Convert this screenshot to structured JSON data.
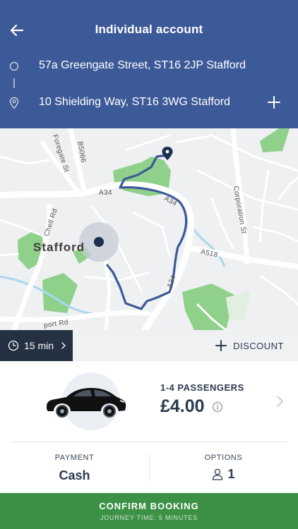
{
  "header": {
    "title": "Individual account",
    "from_address": "57a Greengate Street, ST16 2JP Stafford",
    "to_address": "10 Shielding Way, ST16 3WG Stafford",
    "background_color": "#3d5a98"
  },
  "map": {
    "city": "Stafford",
    "road_labels": {
      "a34_west": "A34",
      "a34_east": "A34",
      "a34_south": "A34",
      "a518": "A518",
      "b5066": "B5066",
      "foregate": "Foregate St",
      "corporation": "Corporation St",
      "chell": "Chell Rd",
      "port": "port Rd"
    },
    "route_color": "#3d5a98"
  },
  "info_bar": {
    "eta": "15 min",
    "discount_label": "DISCOUNT"
  },
  "vehicle": {
    "passengers": "1-4 PASSENGERS",
    "price": "£4.00"
  },
  "payment": {
    "label": "PAYMENT",
    "value": "Cash"
  },
  "options": {
    "label": "OPTIONS",
    "value": "1"
  },
  "confirm": {
    "label": "CONFIRM BOOKING",
    "sub": "JOURNEY TIME: 5 MINUTES",
    "color": "#3d9146"
  }
}
